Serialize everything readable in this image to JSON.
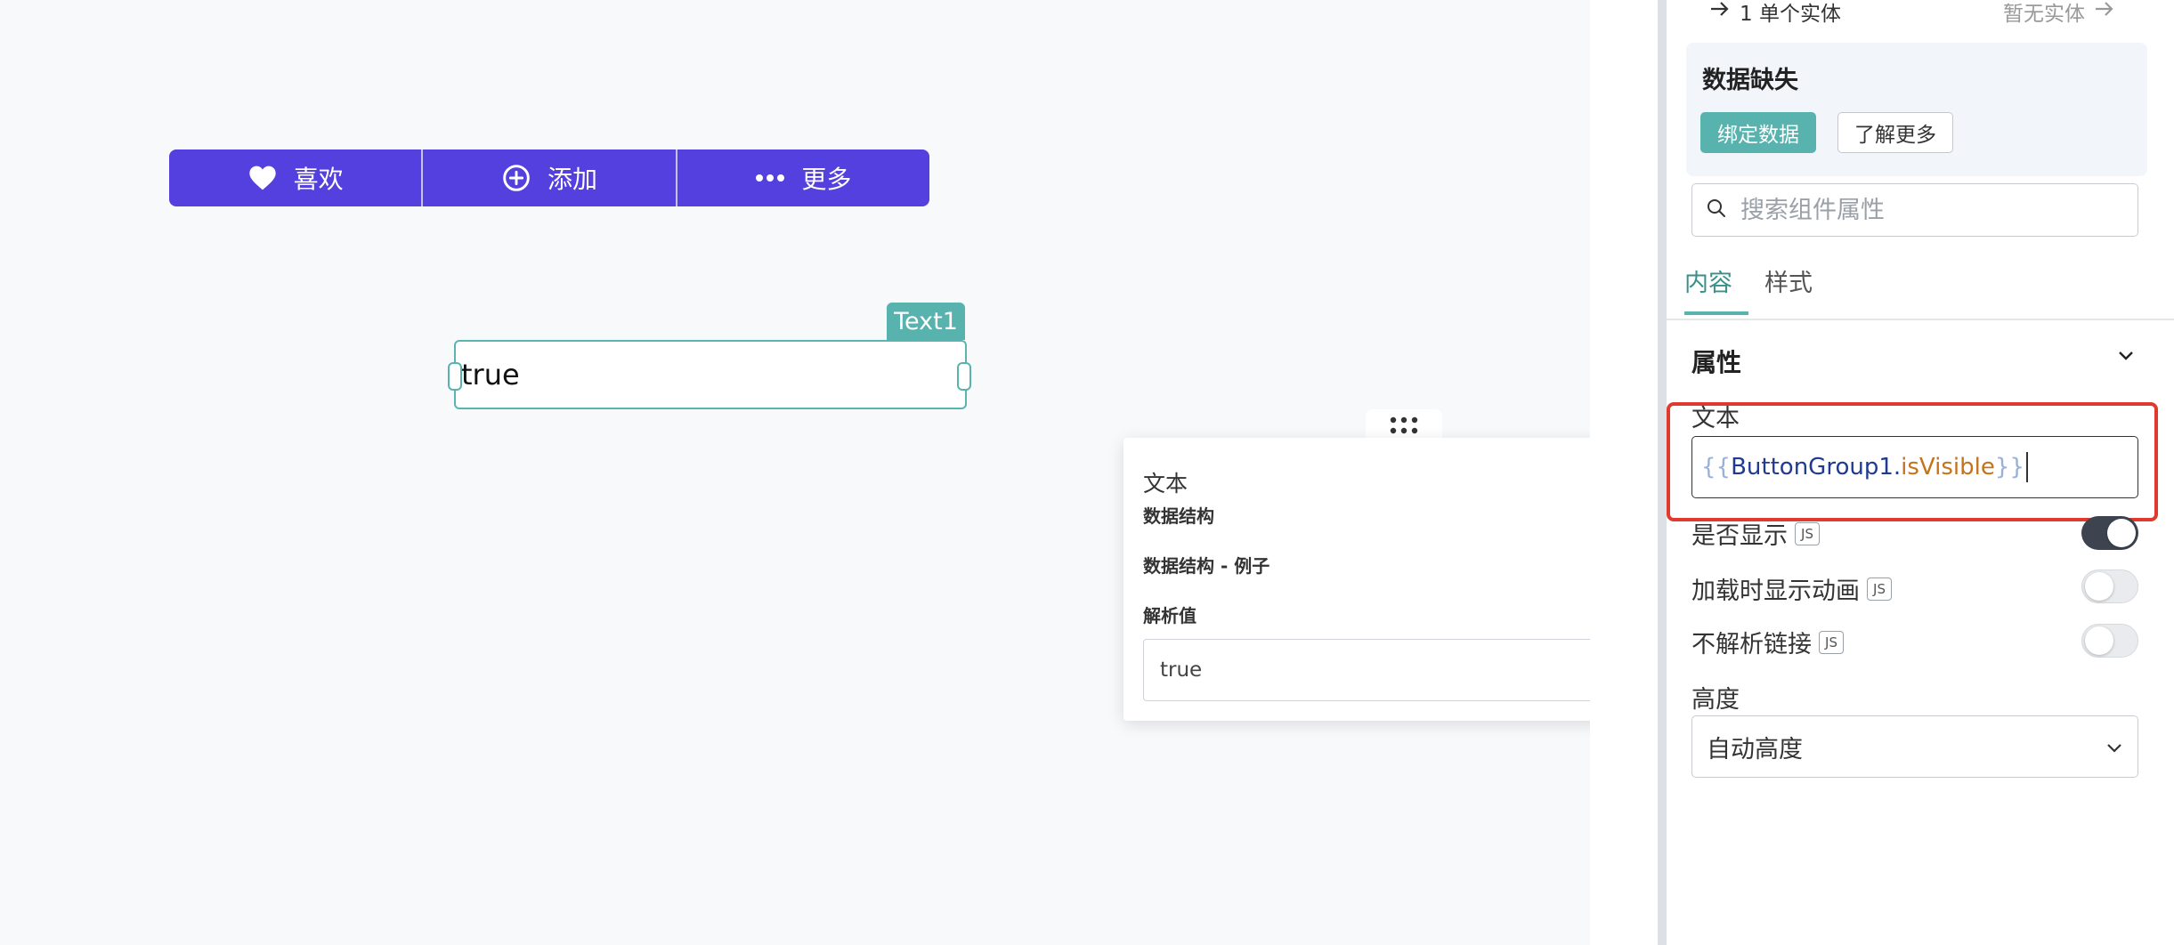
{
  "canvas": {
    "button_group": [
      {
        "label": "喜欢",
        "icon": "heart-icon"
      },
      {
        "label": "添加",
        "icon": "plus-circle-icon"
      },
      {
        "label": "更多",
        "icon": "more-icon"
      }
    ],
    "text_widget": {
      "tag": "Text1",
      "value": "true"
    }
  },
  "popover": {
    "title": "文本",
    "rows": [
      {
        "label": "数据结构",
        "icon": "chevron-right-icon"
      },
      {
        "label": "数据结构 - 例子",
        "icon": "chevron-right-icon"
      },
      {
        "label": "解析值",
        "icon": "chevron-down-icon"
      }
    ],
    "evaluated_value": "true"
  },
  "panel": {
    "entity_link": "1 单个实体",
    "no_entity": "暂无实体",
    "missing": {
      "title": "数据缺失",
      "bind_label": "绑定数据",
      "learn_label": "了解更多"
    },
    "search_placeholder": "搜索组件属性",
    "tabs": [
      "内容",
      "样式"
    ],
    "section_title": "属性",
    "props": {
      "text_label": "文本",
      "text_code": {
        "open": "{{",
        "object": "ButtonGroup1",
        "dot": ".",
        "property": "isVisible",
        "close": "}}"
      },
      "visible_label": "是否显示",
      "animate_label": "加载时显示动画",
      "no_parse_label": "不解析链接",
      "js_badge": "JS",
      "height_label": "高度",
      "height_value": "自动高度"
    },
    "toggles": {
      "visible": true,
      "animate": false,
      "no_parse": false
    },
    "colors": {
      "accent": "#58b3ae",
      "button_group": "#5340de",
      "highlight": "#e03a2f"
    }
  }
}
